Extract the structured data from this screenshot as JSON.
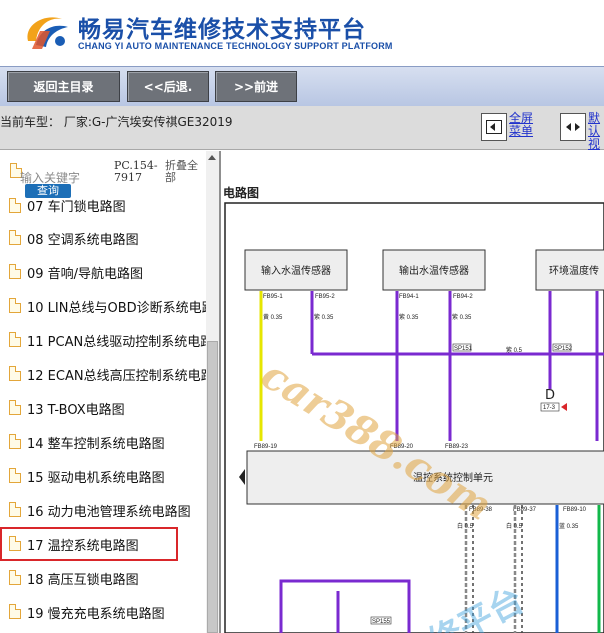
{
  "brand": {
    "title_cn": "畅易汽车维修技术支持平台",
    "title_en": "CHANG YI AUTO MAINTENANCE TECHNOLOGY SUPPORT PLATFORM"
  },
  "nav": {
    "home": "返回主目录",
    "back": "<<后退.",
    "forward": ">>前进"
  },
  "info": {
    "vehicle": "当前车型：  厂家:G-广汽埃安传祺GE32019",
    "fullscreen_label": "全屏",
    "fullscreen_sub": "菜单",
    "default_label": "默认",
    "default_sub": "视图"
  },
  "sidebar": {
    "search_placeholder": "输入关键字",
    "search_button": "查询",
    "code": "PC.154-7917",
    "collapse": "折叠全部",
    "items": [
      {
        "label": "07 车门锁电路图"
      },
      {
        "label": "08 空调系统电路图"
      },
      {
        "label": "09 音响/导航电路图"
      },
      {
        "label": "10 LIN总线与OBD诊断系统电路"
      },
      {
        "label": "11 PCAN总线驱动控制系统电路"
      },
      {
        "label": "12 ECAN总线高压控制系统电路"
      },
      {
        "label": "13 T-BOX电路图"
      },
      {
        "label": "14 整车控制系统电路图"
      },
      {
        "label": "15 驱动电机系统电路图"
      },
      {
        "label": "16 动力电池管理系统电路图"
      },
      {
        "label": "17 温控系统电路图",
        "selected": true
      },
      {
        "label": "18 高压互锁电路图"
      },
      {
        "label": "19 慢充充电系统电路图"
      }
    ]
  },
  "diagram": {
    "title": "电路图",
    "components": {
      "inlet_sensor": "输入水温传感器",
      "outlet_sensor": "输出水温传感器",
      "ambient_sensor": "环境温度传",
      "control_unit": "温控系统控制单元"
    },
    "pins": {
      "fb95_1": "FB95-1",
      "fb95_2": "FB95-2",
      "fb94_1": "FB94-1",
      "fb94_2": "FB94-2",
      "fb89_19": "FB89-19",
      "fb89_20": "FB89-20",
      "fb89_23": "FB89-23",
      "fb89_38": "FB89-38",
      "fb89_37": "FB89-37",
      "fb89_10": "FB89-10",
      "sp151": "SP151",
      "sp152": "SP152",
      "sp155": "SP155",
      "d_label": "D",
      "ref_box": "17-3"
    },
    "wire_labels": {
      "yellow": "黄 0.35",
      "purple": "紫 0.35",
      "purple_b": "紫 0.5",
      "white": "白 0.5",
      "blue": "蓝 0.35"
    },
    "watermark": "car388.com",
    "watermark2": "修平台"
  }
}
